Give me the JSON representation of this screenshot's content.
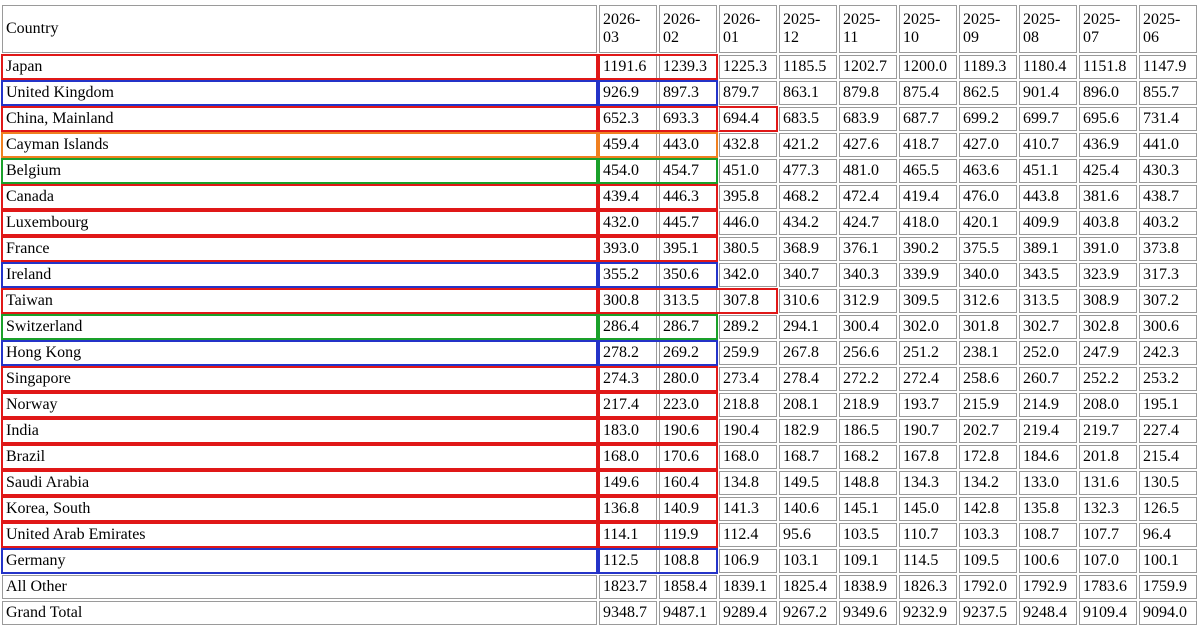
{
  "table": {
    "country_header": "Country",
    "months": [
      "2026-03",
      "2026-02",
      "2026-01",
      "2025-12",
      "2025-11",
      "2025-10",
      "2025-09",
      "2025-08",
      "2025-07",
      "2025-06"
    ],
    "rows": [
      {
        "country": "Japan",
        "values": [
          "1191.6",
          "1239.3",
          "1225.3",
          "1185.5",
          "1202.7",
          "1200.0",
          "1189.3",
          "1180.4",
          "1151.8",
          "1147.9"
        ]
      },
      {
        "country": "United Kingdom",
        "values": [
          "926.9",
          "897.3",
          "879.7",
          "863.1",
          "879.8",
          "875.4",
          "862.5",
          "901.4",
          "896.0",
          "855.7"
        ]
      },
      {
        "country": "China, Mainland",
        "values": [
          "652.3",
          "693.3",
          "694.4",
          "683.5",
          "683.9",
          "687.7",
          "699.2",
          "699.7",
          "695.6",
          "731.4"
        ]
      },
      {
        "country": "Cayman Islands",
        "values": [
          "459.4",
          "443.0",
          "432.8",
          "421.2",
          "427.6",
          "418.7",
          "427.0",
          "410.7",
          "436.9",
          "441.0"
        ]
      },
      {
        "country": "Belgium",
        "values": [
          "454.0",
          "454.7",
          "451.0",
          "477.3",
          "481.0",
          "465.5",
          "463.6",
          "451.1",
          "425.4",
          "430.3"
        ]
      },
      {
        "country": "Canada",
        "values": [
          "439.4",
          "446.3",
          "395.8",
          "468.2",
          "472.4",
          "419.4",
          "476.0",
          "443.8",
          "381.6",
          "438.7"
        ]
      },
      {
        "country": "Luxembourg",
        "values": [
          "432.0",
          "445.7",
          "446.0",
          "434.2",
          "424.7",
          "418.0",
          "420.1",
          "409.9",
          "403.8",
          "403.2"
        ]
      },
      {
        "country": "France",
        "values": [
          "393.0",
          "395.1",
          "380.5",
          "368.9",
          "376.1",
          "390.2",
          "375.5",
          "389.1",
          "391.0",
          "373.8"
        ]
      },
      {
        "country": "Ireland",
        "values": [
          "355.2",
          "350.6",
          "342.0",
          "340.7",
          "340.3",
          "339.9",
          "340.0",
          "343.5",
          "323.9",
          "317.3"
        ]
      },
      {
        "country": "Taiwan",
        "values": [
          "300.8",
          "313.5",
          "307.8",
          "310.6",
          "312.9",
          "309.5",
          "312.6",
          "313.5",
          "308.9",
          "307.2"
        ]
      },
      {
        "country": "Switzerland",
        "values": [
          "286.4",
          "286.7",
          "289.2",
          "294.1",
          "300.4",
          "302.0",
          "301.8",
          "302.7",
          "302.8",
          "300.6"
        ]
      },
      {
        "country": "Hong Kong",
        "values": [
          "278.2",
          "269.2",
          "259.9",
          "267.8",
          "256.6",
          "251.2",
          "238.1",
          "252.0",
          "247.9",
          "242.3"
        ]
      },
      {
        "country": "Singapore",
        "values": [
          "274.3",
          "280.0",
          "273.4",
          "278.4",
          "272.2",
          "272.4",
          "258.6",
          "260.7",
          "252.2",
          "253.2"
        ]
      },
      {
        "country": "Norway",
        "values": [
          "217.4",
          "223.0",
          "218.8",
          "208.1",
          "218.9",
          "193.7",
          "215.9",
          "214.9",
          "208.0",
          "195.1"
        ]
      },
      {
        "country": "India",
        "values": [
          "183.0",
          "190.6",
          "190.4",
          "182.9",
          "186.5",
          "190.7",
          "202.7",
          "219.4",
          "219.7",
          "227.4"
        ]
      },
      {
        "country": "Brazil",
        "values": [
          "168.0",
          "170.6",
          "168.0",
          "168.7",
          "168.2",
          "167.8",
          "172.8",
          "184.6",
          "201.8",
          "215.4"
        ]
      },
      {
        "country": "Saudi Arabia",
        "values": [
          "149.6",
          "160.4",
          "134.8",
          "149.5",
          "148.8",
          "134.3",
          "134.2",
          "133.0",
          "131.6",
          "130.5"
        ]
      },
      {
        "country": "Korea, South",
        "values": [
          "136.8",
          "140.9",
          "141.3",
          "140.6",
          "145.1",
          "145.0",
          "142.8",
          "135.8",
          "132.3",
          "126.5"
        ]
      },
      {
        "country": "United Arab Emirates",
        "values": [
          "114.1",
          "119.9",
          "112.4",
          "95.6",
          "103.5",
          "110.7",
          "103.3",
          "108.7",
          "107.7",
          "96.4"
        ]
      },
      {
        "country": "Germany",
        "values": [
          "112.5",
          "108.8",
          "106.9",
          "103.1",
          "109.1",
          "114.5",
          "109.5",
          "100.6",
          "107.0",
          "100.1"
        ]
      },
      {
        "country": "All Other",
        "values": [
          "1823.7",
          "1858.4",
          "1839.1",
          "1825.4",
          "1838.9",
          "1826.3",
          "1792.0",
          "1792.9",
          "1783.6",
          "1759.9"
        ]
      },
      {
        "country": "Grand Total",
        "values": [
          "9348.7",
          "9487.1",
          "9289.4",
          "9267.2",
          "9349.6",
          "9232.9",
          "9237.5",
          "9248.4",
          "9109.4",
          "9094.0"
        ]
      }
    ]
  },
  "highlight_colors": {
    "red": "#e01818",
    "blue": "#2433c8",
    "orange": "#f08020",
    "green": "#1aa02a"
  },
  "highlights": [
    {
      "row": 0,
      "country_color": "red",
      "values_color": "red",
      "values_span": 2
    },
    {
      "row": 1,
      "country_color": "blue",
      "values_color": "blue",
      "values_span": 2
    },
    {
      "row": 2,
      "country_color": "red",
      "values_color": "red",
      "values_span": 2
    },
    {
      "row": 2,
      "values_color": "red",
      "values_from": 2,
      "values_span": 1,
      "open_left": true
    },
    {
      "row": 3,
      "country_color": "orange",
      "values_color": "orange",
      "values_span": 2
    },
    {
      "row": 4,
      "country_color": "green",
      "values_color": "green",
      "values_span": 2
    },
    {
      "row": 5,
      "country_color": "red",
      "values_color": "red",
      "values_span": 2
    },
    {
      "row": 6,
      "country_color": "red",
      "values_color": "red",
      "values_span": 2
    },
    {
      "row": 7,
      "country_color": "red",
      "values_color": "red",
      "values_span": 2
    },
    {
      "row": 8,
      "country_color": "blue",
      "values_color": "blue",
      "values_span": 2
    },
    {
      "row": 9,
      "country_color": "red",
      "values_color": "red",
      "values_span": 3
    },
    {
      "row": 10,
      "country_color": "green",
      "values_color": "green",
      "values_span": 2
    },
    {
      "row": 11,
      "country_color": "blue",
      "values_color": "blue",
      "values_span": 2
    },
    {
      "row": 12,
      "country_color": "red",
      "values_color": "red",
      "values_span": 2
    },
    {
      "row": 13,
      "country_color": "red",
      "values_color": "red",
      "values_span": 2
    },
    {
      "row": 14,
      "country_color": "red",
      "values_color": "red",
      "values_span": 2
    },
    {
      "row": 15,
      "country_color": "red",
      "values_color": "red",
      "values_span": 2
    },
    {
      "row": 16,
      "country_color": "red",
      "values_color": "red",
      "values_span": 2
    },
    {
      "row": 17,
      "country_color": "red",
      "values_color": "red",
      "values_span": 2
    },
    {
      "row": 18,
      "country_color": "red",
      "values_color": "red",
      "values_span": 2
    },
    {
      "row": 19,
      "country_color": "blue",
      "values_color": "blue",
      "values_span": 2
    }
  ]
}
